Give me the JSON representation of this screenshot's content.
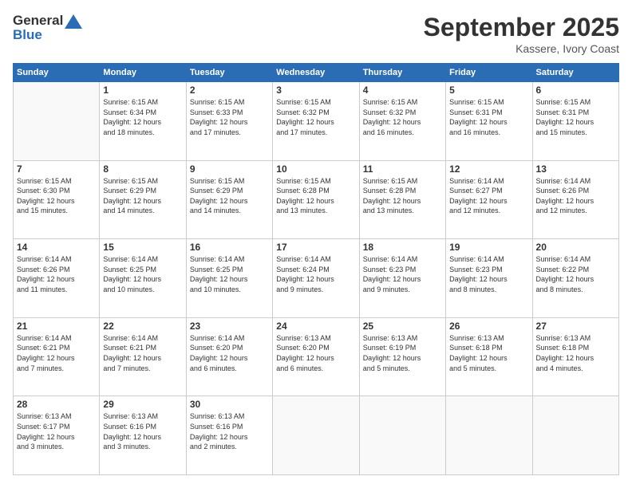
{
  "header": {
    "logo_line1": "General",
    "logo_line2": "Blue",
    "month": "September 2025",
    "location": "Kassere, Ivory Coast"
  },
  "weekdays": [
    "Sunday",
    "Monday",
    "Tuesday",
    "Wednesday",
    "Thursday",
    "Friday",
    "Saturday"
  ],
  "weeks": [
    [
      {
        "day": "",
        "info": ""
      },
      {
        "day": "1",
        "info": "Sunrise: 6:15 AM\nSunset: 6:34 PM\nDaylight: 12 hours\nand 18 minutes."
      },
      {
        "day": "2",
        "info": "Sunrise: 6:15 AM\nSunset: 6:33 PM\nDaylight: 12 hours\nand 17 minutes."
      },
      {
        "day": "3",
        "info": "Sunrise: 6:15 AM\nSunset: 6:32 PM\nDaylight: 12 hours\nand 17 minutes."
      },
      {
        "day": "4",
        "info": "Sunrise: 6:15 AM\nSunset: 6:32 PM\nDaylight: 12 hours\nand 16 minutes."
      },
      {
        "day": "5",
        "info": "Sunrise: 6:15 AM\nSunset: 6:31 PM\nDaylight: 12 hours\nand 16 minutes."
      },
      {
        "day": "6",
        "info": "Sunrise: 6:15 AM\nSunset: 6:31 PM\nDaylight: 12 hours\nand 15 minutes."
      }
    ],
    [
      {
        "day": "7",
        "info": "Sunrise: 6:15 AM\nSunset: 6:30 PM\nDaylight: 12 hours\nand 15 minutes."
      },
      {
        "day": "8",
        "info": "Sunrise: 6:15 AM\nSunset: 6:29 PM\nDaylight: 12 hours\nand 14 minutes."
      },
      {
        "day": "9",
        "info": "Sunrise: 6:15 AM\nSunset: 6:29 PM\nDaylight: 12 hours\nand 14 minutes."
      },
      {
        "day": "10",
        "info": "Sunrise: 6:15 AM\nSunset: 6:28 PM\nDaylight: 12 hours\nand 13 minutes."
      },
      {
        "day": "11",
        "info": "Sunrise: 6:15 AM\nSunset: 6:28 PM\nDaylight: 12 hours\nand 13 minutes."
      },
      {
        "day": "12",
        "info": "Sunrise: 6:14 AM\nSunset: 6:27 PM\nDaylight: 12 hours\nand 12 minutes."
      },
      {
        "day": "13",
        "info": "Sunrise: 6:14 AM\nSunset: 6:26 PM\nDaylight: 12 hours\nand 12 minutes."
      }
    ],
    [
      {
        "day": "14",
        "info": "Sunrise: 6:14 AM\nSunset: 6:26 PM\nDaylight: 12 hours\nand 11 minutes."
      },
      {
        "day": "15",
        "info": "Sunrise: 6:14 AM\nSunset: 6:25 PM\nDaylight: 12 hours\nand 10 minutes."
      },
      {
        "day": "16",
        "info": "Sunrise: 6:14 AM\nSunset: 6:25 PM\nDaylight: 12 hours\nand 10 minutes."
      },
      {
        "day": "17",
        "info": "Sunrise: 6:14 AM\nSunset: 6:24 PM\nDaylight: 12 hours\nand 9 minutes."
      },
      {
        "day": "18",
        "info": "Sunrise: 6:14 AM\nSunset: 6:23 PM\nDaylight: 12 hours\nand 9 minutes."
      },
      {
        "day": "19",
        "info": "Sunrise: 6:14 AM\nSunset: 6:23 PM\nDaylight: 12 hours\nand 8 minutes."
      },
      {
        "day": "20",
        "info": "Sunrise: 6:14 AM\nSunset: 6:22 PM\nDaylight: 12 hours\nand 8 minutes."
      }
    ],
    [
      {
        "day": "21",
        "info": "Sunrise: 6:14 AM\nSunset: 6:21 PM\nDaylight: 12 hours\nand 7 minutes."
      },
      {
        "day": "22",
        "info": "Sunrise: 6:14 AM\nSunset: 6:21 PM\nDaylight: 12 hours\nand 7 minutes."
      },
      {
        "day": "23",
        "info": "Sunrise: 6:14 AM\nSunset: 6:20 PM\nDaylight: 12 hours\nand 6 minutes."
      },
      {
        "day": "24",
        "info": "Sunrise: 6:13 AM\nSunset: 6:20 PM\nDaylight: 12 hours\nand 6 minutes."
      },
      {
        "day": "25",
        "info": "Sunrise: 6:13 AM\nSunset: 6:19 PM\nDaylight: 12 hours\nand 5 minutes."
      },
      {
        "day": "26",
        "info": "Sunrise: 6:13 AM\nSunset: 6:18 PM\nDaylight: 12 hours\nand 5 minutes."
      },
      {
        "day": "27",
        "info": "Sunrise: 6:13 AM\nSunset: 6:18 PM\nDaylight: 12 hours\nand 4 minutes."
      }
    ],
    [
      {
        "day": "28",
        "info": "Sunrise: 6:13 AM\nSunset: 6:17 PM\nDaylight: 12 hours\nand 3 minutes."
      },
      {
        "day": "29",
        "info": "Sunrise: 6:13 AM\nSunset: 6:16 PM\nDaylight: 12 hours\nand 3 minutes."
      },
      {
        "day": "30",
        "info": "Sunrise: 6:13 AM\nSunset: 6:16 PM\nDaylight: 12 hours\nand 2 minutes."
      },
      {
        "day": "",
        "info": ""
      },
      {
        "day": "",
        "info": ""
      },
      {
        "day": "",
        "info": ""
      },
      {
        "day": "",
        "info": ""
      }
    ]
  ]
}
